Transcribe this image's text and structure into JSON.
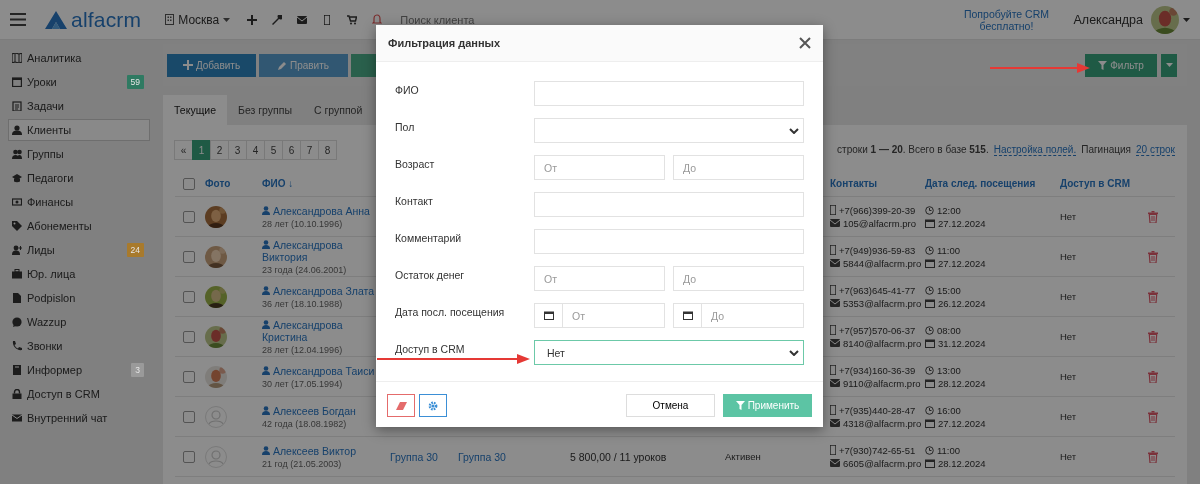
{
  "topbar": {
    "logo": "alfacrm",
    "city": "Москва",
    "search": {
      "placeholder": "Поиск клиента"
    },
    "promo": "Попробуйте CRM бесплатно!",
    "user": "Александра"
  },
  "sidebar": {
    "items": [
      {
        "label": "Аналитика",
        "selected": false
      },
      {
        "label": "Уроки",
        "selected": false,
        "badge": {
          "text": "59",
          "color": "#2f7a62"
        }
      },
      {
        "label": "Задачи",
        "selected": false
      },
      {
        "label": "Клиенты",
        "selected": true
      },
      {
        "label": "Группы",
        "selected": false
      },
      {
        "label": "Педагоги",
        "selected": false
      },
      {
        "label": "Финансы",
        "selected": false
      },
      {
        "label": "Абонементы",
        "selected": false
      },
      {
        "label": "Лиды",
        "selected": false,
        "badge": {
          "text": "24",
          "color": "#a87a2c"
        }
      },
      {
        "label": "Юр. лица",
        "selected": false
      },
      {
        "label": "Podpislon",
        "selected": false
      },
      {
        "label": "Wazzup",
        "selected": false
      },
      {
        "label": "Звонки",
        "selected": false
      },
      {
        "label": "Информер",
        "selected": false,
        "badge": {
          "text": "3",
          "color": "#9a9a9a"
        }
      },
      {
        "label": "Доступ в CRM",
        "selected": false
      },
      {
        "label": "Внутренний чат",
        "selected": false
      }
    ]
  },
  "toolbar": {
    "buttons": [
      {
        "label": "Добавить",
        "kind": "add"
      },
      {
        "label": "Править",
        "kind": "edit"
      }
    ],
    "filter_button": "Фильтр"
  },
  "tabs": [
    {
      "label": "Текущие",
      "selected": true
    },
    {
      "label": "Без группы",
      "selected": false
    },
    {
      "label": "С группой",
      "selected": false
    }
  ],
  "pagination": {
    "pages": [
      {
        "label": "«",
        "selected": false
      },
      {
        "label": "1",
        "selected": true
      },
      {
        "label": "2",
        "selected": false
      },
      {
        "label": "3",
        "selected": false
      },
      {
        "label": "4",
        "selected": false
      },
      {
        "label": "5",
        "selected": false
      },
      {
        "label": "6",
        "selected": false
      },
      {
        "label": "7",
        "selected": false
      },
      {
        "label": "8",
        "selected": false
      }
    ],
    "summary": "строки **1 — 20**. Всего в базе **515**.",
    "fields_link": "Настройка полей.",
    "pagination_label": "Пагинация",
    "rows_link": "20 строк"
  },
  "table": {
    "select_all": {
      "checked": false
    },
    "columns": [
      "Фото",
      "ФИО ↓",
      "Контакты",
      "Дата след. посещения",
      "Доступ в CRM"
    ],
    "rows": [
      {
        "checked": false,
        "has_photo": true,
        "name": "Александрова Анна",
        "age": "28 лет (10.10.1996)",
        "phone": "+7(966)399-20-39",
        "email": "105@alfacrm.pro",
        "time": "12:00",
        "date": "27.12.2024",
        "access": "Нет"
      },
      {
        "checked": false,
        "has_photo": true,
        "name": "Александрова Виктория",
        "age": "23 года (24.06.2001)",
        "phone": "+7(949)936-59-83",
        "email": "5844@alfacrm.pro",
        "time": "11:00",
        "date": "27.12.2024",
        "access": "Нет"
      },
      {
        "checked": false,
        "has_photo": true,
        "name": "Александрова Злата",
        "age": "36 лет (18.10.1988)",
        "phone": "+7(963)645-41-77",
        "email": "5353@alfacrm.pro",
        "time": "15:00",
        "date": "26.12.2024",
        "access": "Нет"
      },
      {
        "checked": false,
        "has_photo": true,
        "name": "Александрова Кристина",
        "age": "28 лет (12.04.1996)",
        "phone": "+7(957)570-06-37",
        "email": "8140@alfacrm.pro",
        "time": "08:00",
        "date": "31.12.2024",
        "access": "Нет"
      },
      {
        "checked": false,
        "has_photo": true,
        "name": "Александрова Таиси",
        "age": "30 лет (17.05.1994)",
        "phone": "+7(934)160-36-39",
        "email": "9110@alfacrm.pro",
        "time": "13:00",
        "date": "28.12.2024",
        "access": "Нет"
      },
      {
        "checked": false,
        "has_photo": false,
        "name": "Алексеев Богдан",
        "age": "42 года (18.08.1982)",
        "phone": "+7(935)440-28-47",
        "email": "4318@alfacrm.pro",
        "time": "16:00",
        "date": "27.12.2024",
        "access": "Нет"
      },
      {
        "checked": false,
        "has_photo": false,
        "name": "Алексеев Виктор",
        "age": "21 год (21.05.2003)",
        "group_1": "Группа 30",
        "group_2": "Группа 30",
        "balance": "5 800,00 / 11 уроков",
        "status": "Активен",
        "phone": "+7(930)742-65-51",
        "email": "6605@alfacrm.pro",
        "time": "11:00",
        "date": "28.12.2024",
        "access": "Нет"
      }
    ]
  },
  "modal": {
    "title": "Фильтрация данных",
    "fields": [
      {
        "label": "ФИО",
        "kind": "text",
        "focused": false
      },
      {
        "label": "Пол",
        "kind": "select",
        "focused": false
      },
      {
        "label": "Возраст",
        "kind": "range",
        "from_placeholder": "От",
        "to_placeholder": "До",
        "focused": false
      },
      {
        "label": "Контакт",
        "kind": "text",
        "focused": false
      },
      {
        "label": "Комментарий",
        "kind": "text",
        "focused": false
      },
      {
        "label": "Остаток денег",
        "kind": "range",
        "from_placeholder": "От",
        "to_placeholder": "До",
        "focused": false
      },
      {
        "label": "Дата посл. посещения",
        "kind": "date_range",
        "from_placeholder": "От",
        "to_placeholder": "До",
        "focused": false
      },
      {
        "label": "Доступ в CRM",
        "kind": "select",
        "value": "Нет",
        "focused": true
      }
    ],
    "cancel": "Отмена",
    "apply": "Применить"
  }
}
